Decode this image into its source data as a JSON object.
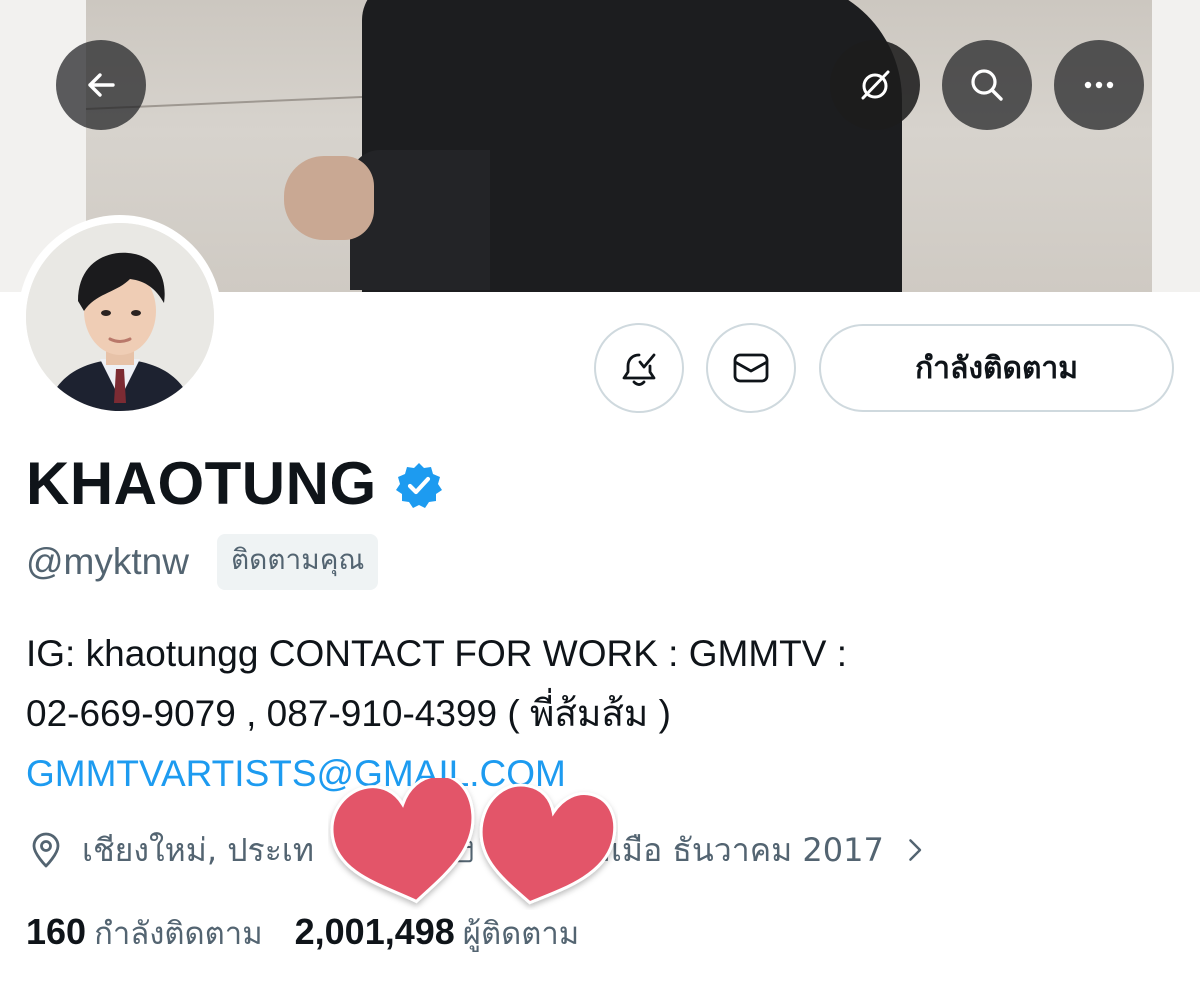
{
  "header": {
    "back_icon": "arrow-left-icon",
    "grok_icon": "grok-slash-circle-icon",
    "search_icon": "search-icon",
    "more_icon": "more-horizontal-icon"
  },
  "actions": {
    "notify_icon": "bell-check-icon",
    "message_icon": "envelope-icon",
    "following_label": "กำลังติดตาม"
  },
  "profile": {
    "display_name": "KHAOTUNG",
    "verified_icon": "verified-badge-icon",
    "verified_color": "#1d9bf0",
    "handle": "@myktnw",
    "follows_you_label": "ติดตามคุณ",
    "bio_line1": "IG: khaotungg CONTACT FOR WORK : GMMTV :",
    "bio_line2": "02-669-9079 , 087-910-4399 ( พี่ส้มส้ม )",
    "bio_link": "GMMTVARTISTS@GMAIL.COM",
    "location_icon": "location-pin-icon",
    "location": "เชียงใหม่, ประเท",
    "calendar_icon": "calendar-icon",
    "joined": "วมเมือ ธันวาคม 2017",
    "chevron_icon": "chevron-right-icon",
    "overlay_icon": "heart-stickers-icon"
  },
  "stats": {
    "following_count": "160",
    "following_label": "กำลังติดตาม",
    "followers_count": "2,001,498",
    "followers_label": "ผู้ติดตาม"
  },
  "colors": {
    "text_primary": "#0f1419",
    "text_secondary": "#536471",
    "link": "#1d9bf0",
    "heart": "#e35469",
    "border": "#cfd9de"
  }
}
